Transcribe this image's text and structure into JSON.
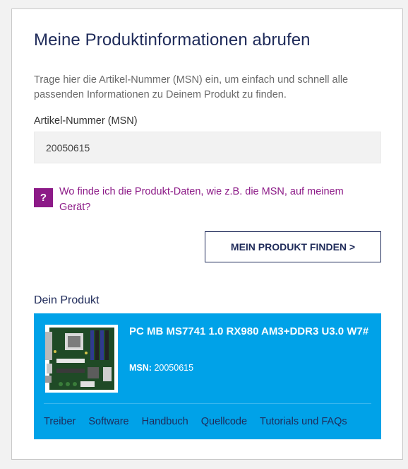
{
  "header": {
    "title": "Meine Produktinformationen abrufen",
    "description": "Trage hier die Artikel-Nummer (MSN) ein, um einfach und schnell alle passenden Informationen zu Deinem Produkt zu finden."
  },
  "form": {
    "msn_label": "Artikel-Nummer (MSN)",
    "msn_value": "20050615",
    "help_icon_text": "?",
    "help_icon": "question-mark-icon",
    "help_text": "Wo finde ich die Produkt-Daten, wie z.B. die MSN, auf meinem Gerät?",
    "find_button_label": "MEIN PRODUKT FINDEN >"
  },
  "product": {
    "section_label": "Dein Produkt",
    "name": "PC MB MS7741 1.0 RX980 AM3+DDR3 U3.0 W7#",
    "msn_label": "MSN:",
    "msn_value": "20050615",
    "links": [
      "Treiber",
      "Software",
      "Handbuch",
      "Quellcode",
      "Tutorials und FAQs"
    ]
  },
  "colors": {
    "title": "#1f2b5a",
    "accent_purple": "#8c1a87",
    "product_bg": "#00a2e8",
    "link_text": "#1f2b5a"
  }
}
